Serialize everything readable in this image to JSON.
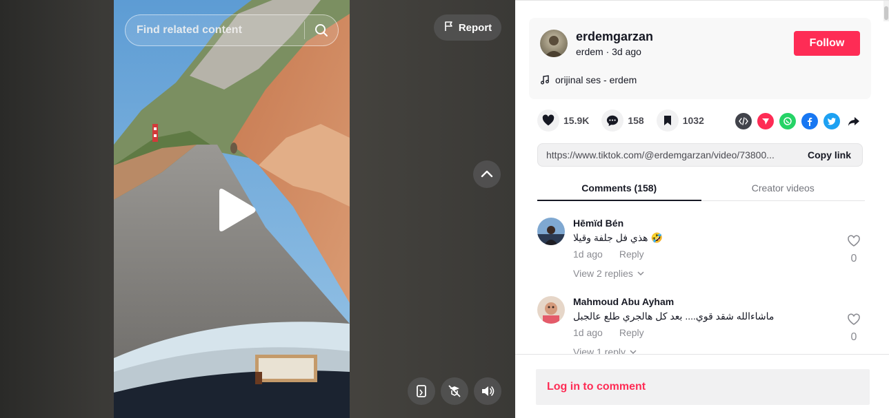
{
  "video": {
    "search_placeholder": "Find related content",
    "report_label": "Report"
  },
  "author": {
    "username": "erdemgarzan",
    "nickname": "erdem",
    "separator": " · ",
    "posted": "3d ago",
    "follow_label": "Follow",
    "music": "orijinal ses - erdem"
  },
  "stats": {
    "likes": "15.9K",
    "comments": "158",
    "saves": "1032"
  },
  "share": {
    "link_url": "https://www.tiktok.com/@erdemgarzan/video/73800...",
    "copy_label": "Copy link",
    "icons": [
      "embed-icon",
      "send-icon",
      "whatsapp-icon",
      "facebook-icon",
      "twitter-icon",
      "share-arrow-icon"
    ]
  },
  "tabs": {
    "comments_label": "Comments (158)",
    "creator_label": "Creator videos"
  },
  "comments": [
    {
      "name": "Hēmïd Bén",
      "text": "هذي فل جلفة وقيلا 🤣",
      "time": "1d ago",
      "reply_label": "Reply",
      "replies": "View 2 replies",
      "likes": "0"
    },
    {
      "name": "Mahmoud Abu Ayham",
      "text": "ماشاءالله شقد قوي.... بعد كل هالجري طلع عالجبل",
      "time": "1d ago",
      "reply_label": "Reply",
      "replies": "View 1 reply",
      "likes": "0"
    }
  ],
  "footer": {
    "login_label": "Log in to comment"
  },
  "colors": {
    "brand": "#fe2c55",
    "text": "#161823",
    "muted": "#8a8b91"
  }
}
